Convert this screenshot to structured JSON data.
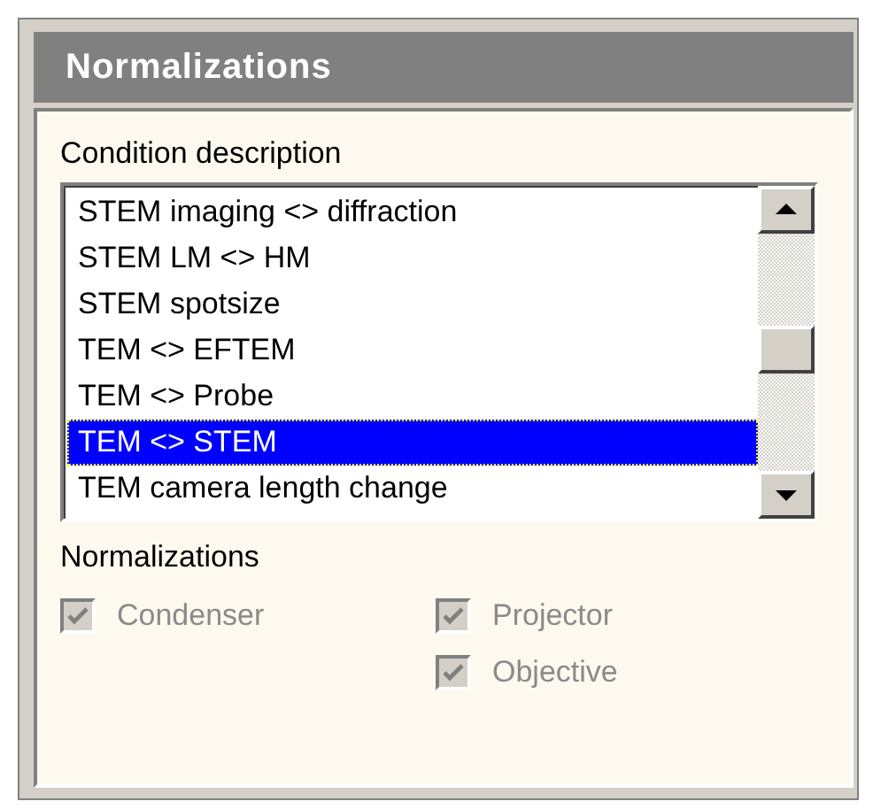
{
  "panel": {
    "title": "Normalizations"
  },
  "condition_list": {
    "label": "Condition description",
    "items": [
      {
        "label": "STEM imaging <> diffraction",
        "selected": false
      },
      {
        "label": "STEM LM <> HM",
        "selected": false
      },
      {
        "label": "STEM spotsize",
        "selected": false
      },
      {
        "label": "TEM <> EFTEM",
        "selected": false
      },
      {
        "label": "TEM <> Probe",
        "selected": false
      },
      {
        "label": "TEM <> STEM",
        "selected": true
      },
      {
        "label": "TEM camera length change",
        "selected": false
      }
    ]
  },
  "normalizations": {
    "label": "Normalizations",
    "columns": [
      [
        {
          "label": "Condenser",
          "checked": true,
          "disabled": true
        }
      ],
      [
        {
          "label": "Projector",
          "checked": true,
          "disabled": true
        },
        {
          "label": "Objective",
          "checked": true,
          "disabled": true
        }
      ]
    ]
  }
}
